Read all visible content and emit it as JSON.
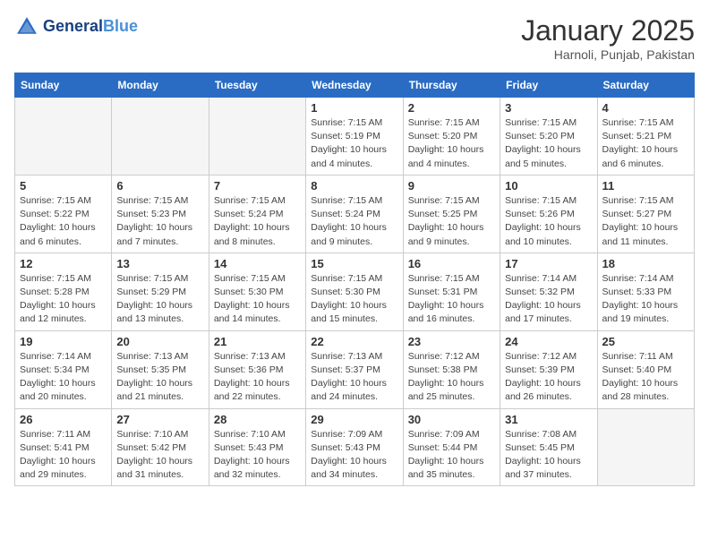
{
  "header": {
    "logo_line1": "General",
    "logo_line2": "Blue",
    "month_title": "January 2025",
    "location": "Harnoli, Punjab, Pakistan"
  },
  "days_of_week": [
    "Sunday",
    "Monday",
    "Tuesday",
    "Wednesday",
    "Thursday",
    "Friday",
    "Saturday"
  ],
  "weeks": [
    [
      {
        "num": "",
        "info": ""
      },
      {
        "num": "",
        "info": ""
      },
      {
        "num": "",
        "info": ""
      },
      {
        "num": "1",
        "info": "Sunrise: 7:15 AM\nSunset: 5:19 PM\nDaylight: 10 hours\nand 4 minutes."
      },
      {
        "num": "2",
        "info": "Sunrise: 7:15 AM\nSunset: 5:20 PM\nDaylight: 10 hours\nand 4 minutes."
      },
      {
        "num": "3",
        "info": "Sunrise: 7:15 AM\nSunset: 5:20 PM\nDaylight: 10 hours\nand 5 minutes."
      },
      {
        "num": "4",
        "info": "Sunrise: 7:15 AM\nSunset: 5:21 PM\nDaylight: 10 hours\nand 6 minutes."
      }
    ],
    [
      {
        "num": "5",
        "info": "Sunrise: 7:15 AM\nSunset: 5:22 PM\nDaylight: 10 hours\nand 6 minutes."
      },
      {
        "num": "6",
        "info": "Sunrise: 7:15 AM\nSunset: 5:23 PM\nDaylight: 10 hours\nand 7 minutes."
      },
      {
        "num": "7",
        "info": "Sunrise: 7:15 AM\nSunset: 5:24 PM\nDaylight: 10 hours\nand 8 minutes."
      },
      {
        "num": "8",
        "info": "Sunrise: 7:15 AM\nSunset: 5:24 PM\nDaylight: 10 hours\nand 9 minutes."
      },
      {
        "num": "9",
        "info": "Sunrise: 7:15 AM\nSunset: 5:25 PM\nDaylight: 10 hours\nand 9 minutes."
      },
      {
        "num": "10",
        "info": "Sunrise: 7:15 AM\nSunset: 5:26 PM\nDaylight: 10 hours\nand 10 minutes."
      },
      {
        "num": "11",
        "info": "Sunrise: 7:15 AM\nSunset: 5:27 PM\nDaylight: 10 hours\nand 11 minutes."
      }
    ],
    [
      {
        "num": "12",
        "info": "Sunrise: 7:15 AM\nSunset: 5:28 PM\nDaylight: 10 hours\nand 12 minutes."
      },
      {
        "num": "13",
        "info": "Sunrise: 7:15 AM\nSunset: 5:29 PM\nDaylight: 10 hours\nand 13 minutes."
      },
      {
        "num": "14",
        "info": "Sunrise: 7:15 AM\nSunset: 5:30 PM\nDaylight: 10 hours\nand 14 minutes."
      },
      {
        "num": "15",
        "info": "Sunrise: 7:15 AM\nSunset: 5:30 PM\nDaylight: 10 hours\nand 15 minutes."
      },
      {
        "num": "16",
        "info": "Sunrise: 7:15 AM\nSunset: 5:31 PM\nDaylight: 10 hours\nand 16 minutes."
      },
      {
        "num": "17",
        "info": "Sunrise: 7:14 AM\nSunset: 5:32 PM\nDaylight: 10 hours\nand 17 minutes."
      },
      {
        "num": "18",
        "info": "Sunrise: 7:14 AM\nSunset: 5:33 PM\nDaylight: 10 hours\nand 19 minutes."
      }
    ],
    [
      {
        "num": "19",
        "info": "Sunrise: 7:14 AM\nSunset: 5:34 PM\nDaylight: 10 hours\nand 20 minutes."
      },
      {
        "num": "20",
        "info": "Sunrise: 7:13 AM\nSunset: 5:35 PM\nDaylight: 10 hours\nand 21 minutes."
      },
      {
        "num": "21",
        "info": "Sunrise: 7:13 AM\nSunset: 5:36 PM\nDaylight: 10 hours\nand 22 minutes."
      },
      {
        "num": "22",
        "info": "Sunrise: 7:13 AM\nSunset: 5:37 PM\nDaylight: 10 hours\nand 24 minutes."
      },
      {
        "num": "23",
        "info": "Sunrise: 7:12 AM\nSunset: 5:38 PM\nDaylight: 10 hours\nand 25 minutes."
      },
      {
        "num": "24",
        "info": "Sunrise: 7:12 AM\nSunset: 5:39 PM\nDaylight: 10 hours\nand 26 minutes."
      },
      {
        "num": "25",
        "info": "Sunrise: 7:11 AM\nSunset: 5:40 PM\nDaylight: 10 hours\nand 28 minutes."
      }
    ],
    [
      {
        "num": "26",
        "info": "Sunrise: 7:11 AM\nSunset: 5:41 PM\nDaylight: 10 hours\nand 29 minutes."
      },
      {
        "num": "27",
        "info": "Sunrise: 7:10 AM\nSunset: 5:42 PM\nDaylight: 10 hours\nand 31 minutes."
      },
      {
        "num": "28",
        "info": "Sunrise: 7:10 AM\nSunset: 5:43 PM\nDaylight: 10 hours\nand 32 minutes."
      },
      {
        "num": "29",
        "info": "Sunrise: 7:09 AM\nSunset: 5:43 PM\nDaylight: 10 hours\nand 34 minutes."
      },
      {
        "num": "30",
        "info": "Sunrise: 7:09 AM\nSunset: 5:44 PM\nDaylight: 10 hours\nand 35 minutes."
      },
      {
        "num": "31",
        "info": "Sunrise: 7:08 AM\nSunset: 5:45 PM\nDaylight: 10 hours\nand 37 minutes."
      },
      {
        "num": "",
        "info": ""
      }
    ]
  ]
}
